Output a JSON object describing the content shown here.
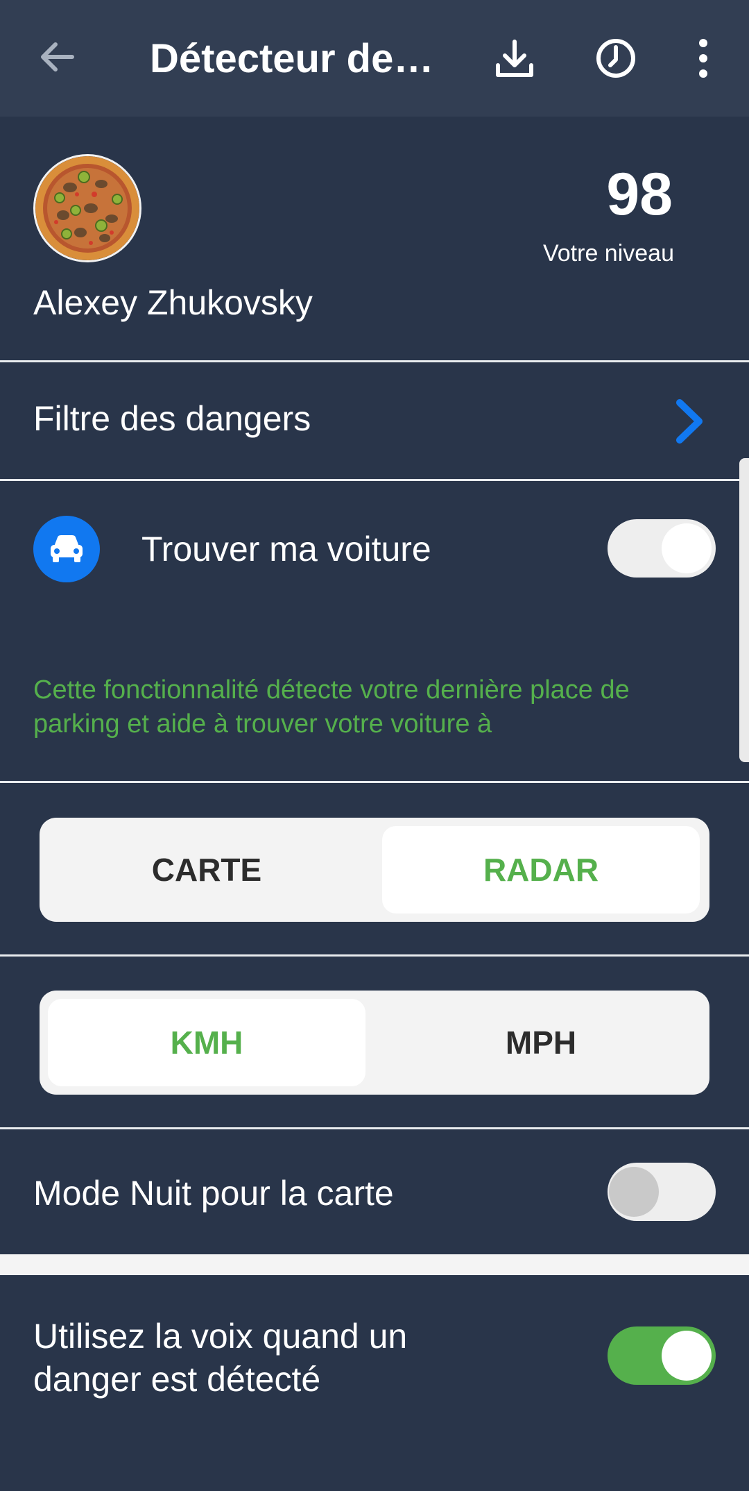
{
  "header": {
    "back_icon": "arrow-left-icon",
    "title": "Détecteur de r...",
    "download_icon": "download-icon",
    "history_icon": "history-clock-icon",
    "more_icon": "more-vertical-icon"
  },
  "profile": {
    "name": "Alexey Zhukovsky",
    "level_value": "98",
    "level_label": "Votre niveau",
    "avatar_icon": "pizza-avatar"
  },
  "hazard_filter": {
    "label": "Filtre des dangers",
    "chevron_icon": "chevron-right-icon"
  },
  "find_car": {
    "label": "Trouver ma voiture",
    "icon": "car-icon",
    "enabled": false,
    "info": "Cette fonctionnalité détecte votre dernière place de parking et aide à trouver votre voiture à"
  },
  "view_mode": {
    "options": [
      "CARTE",
      "RADAR"
    ],
    "selected": "RADAR"
  },
  "units": {
    "options": [
      "KMH",
      "MPH"
    ],
    "selected": "KMH"
  },
  "night_mode": {
    "label": "Mode Nuit pour la carte",
    "enabled": false
  },
  "voice": {
    "label_line1": "Utilisez la voix quand un",
    "label_line2": "danger est détecté",
    "enabled": true
  },
  "colors": {
    "background": "#29354a",
    "topbar": "#323e53",
    "accent_blue": "#1178f0",
    "accent_green": "#55b04c"
  }
}
